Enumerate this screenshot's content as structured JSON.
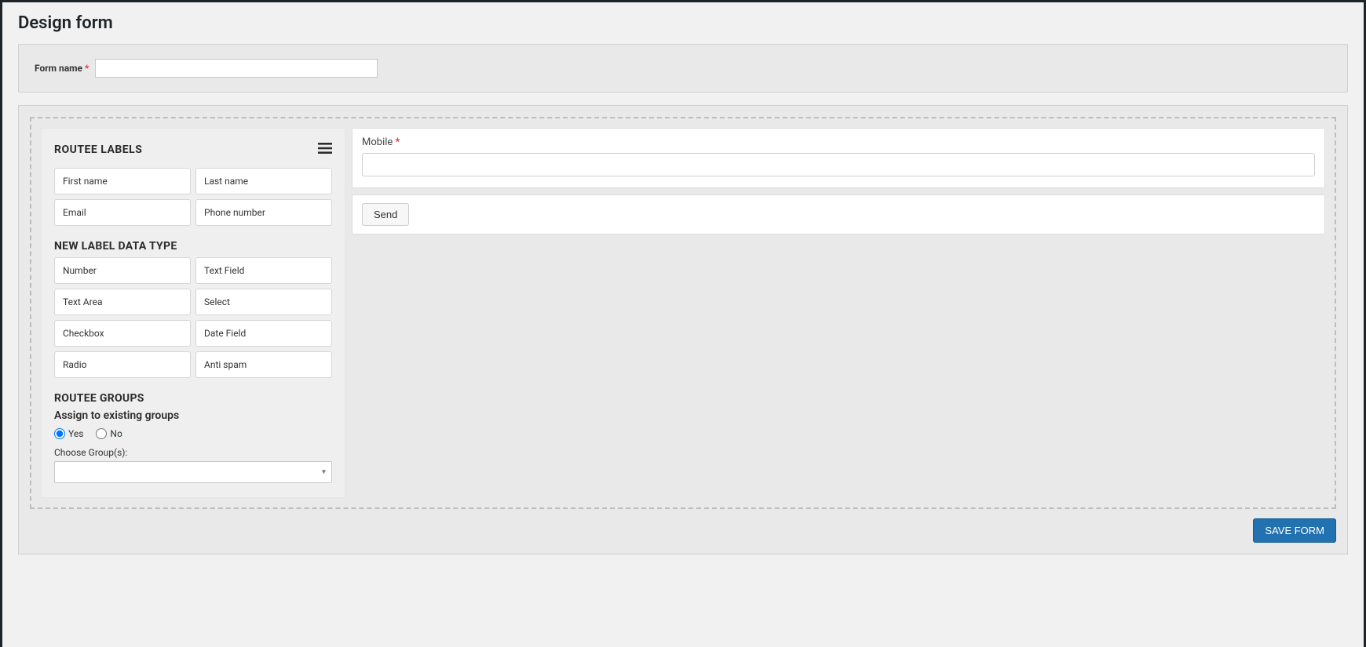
{
  "page": {
    "title": "Design form"
  },
  "topCard": {
    "formNameLabel": "Form name",
    "required": "*",
    "formNameValue": ""
  },
  "leftPanel": {
    "routeeLabelsTitle": "ROUTEE LABELS",
    "routeeLabelChips": [
      "First name",
      "Last name",
      "Email",
      "Phone number"
    ],
    "newLabelTitle": "NEW LABEL DATA TYPE",
    "newLabelChips": [
      "Number",
      "Text Field",
      "Text Area",
      "Select",
      "Checkbox",
      "Date Field",
      "Radio",
      "Anti spam"
    ],
    "routeeGroupsTitle": "ROUTEE GROUPS",
    "assignSubtitle": "Assign to existing groups",
    "radioYes": "Yes",
    "radioNo": "No",
    "chooseGroupsLabel": "Choose Group(s):",
    "selectedGroup": ""
  },
  "preview": {
    "mobileLabel": "Mobile",
    "mobileRequired": "*",
    "mobileValue": "",
    "sendLabel": "Send"
  },
  "actions": {
    "saveButton": "SAVE FORM"
  }
}
